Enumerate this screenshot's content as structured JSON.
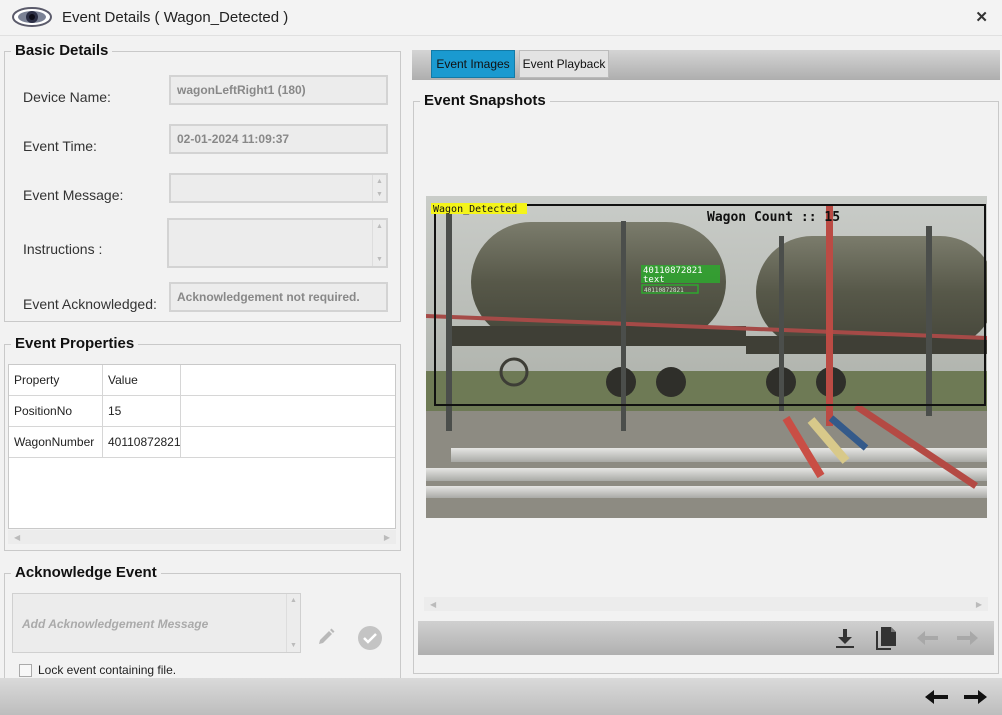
{
  "window": {
    "title": "Event Details ( Wagon_Detected )"
  },
  "basic_details": {
    "legend": "Basic Details",
    "device_name_label": "Device Name:",
    "device_name_value": "wagonLeftRight1 (180)",
    "event_time_label": "Event Time:",
    "event_time_value": "02-01-2024 11:09:37",
    "event_message_label": "Event Message:",
    "event_message_value": "",
    "instructions_label": "Instructions :",
    "instructions_value": "",
    "event_ack_label": "Event Acknowledged:",
    "event_ack_value": "Acknowledgement not required."
  },
  "event_properties": {
    "legend": "Event Properties",
    "headers": [
      "Property",
      "Value"
    ],
    "rows": [
      [
        "PositionNo",
        "15"
      ],
      [
        "WagonNumber",
        "40110872821"
      ]
    ]
  },
  "acknowledge_event": {
    "legend": "Acknowledge Event",
    "placeholder": "Add Acknowledgement Message",
    "lock_label": "Lock event containing file."
  },
  "tabs": [
    {
      "label": "Event Images",
      "active": true
    },
    {
      "label": "Event Playback",
      "active": false
    }
  ],
  "snapshots": {
    "legend": "Event Snapshots",
    "overlay_label": "Wagon_Detected",
    "wagon_count_text": "Wagon Count :: 15",
    "ocr_number": "40110872821",
    "ocr_text": "text",
    "ocr_small": "40110872821"
  },
  "colors": {
    "accent_tab": "#1a9ad0",
    "overlay_yellow": "#f4f41a",
    "ocr_green": "#2ea82e"
  }
}
